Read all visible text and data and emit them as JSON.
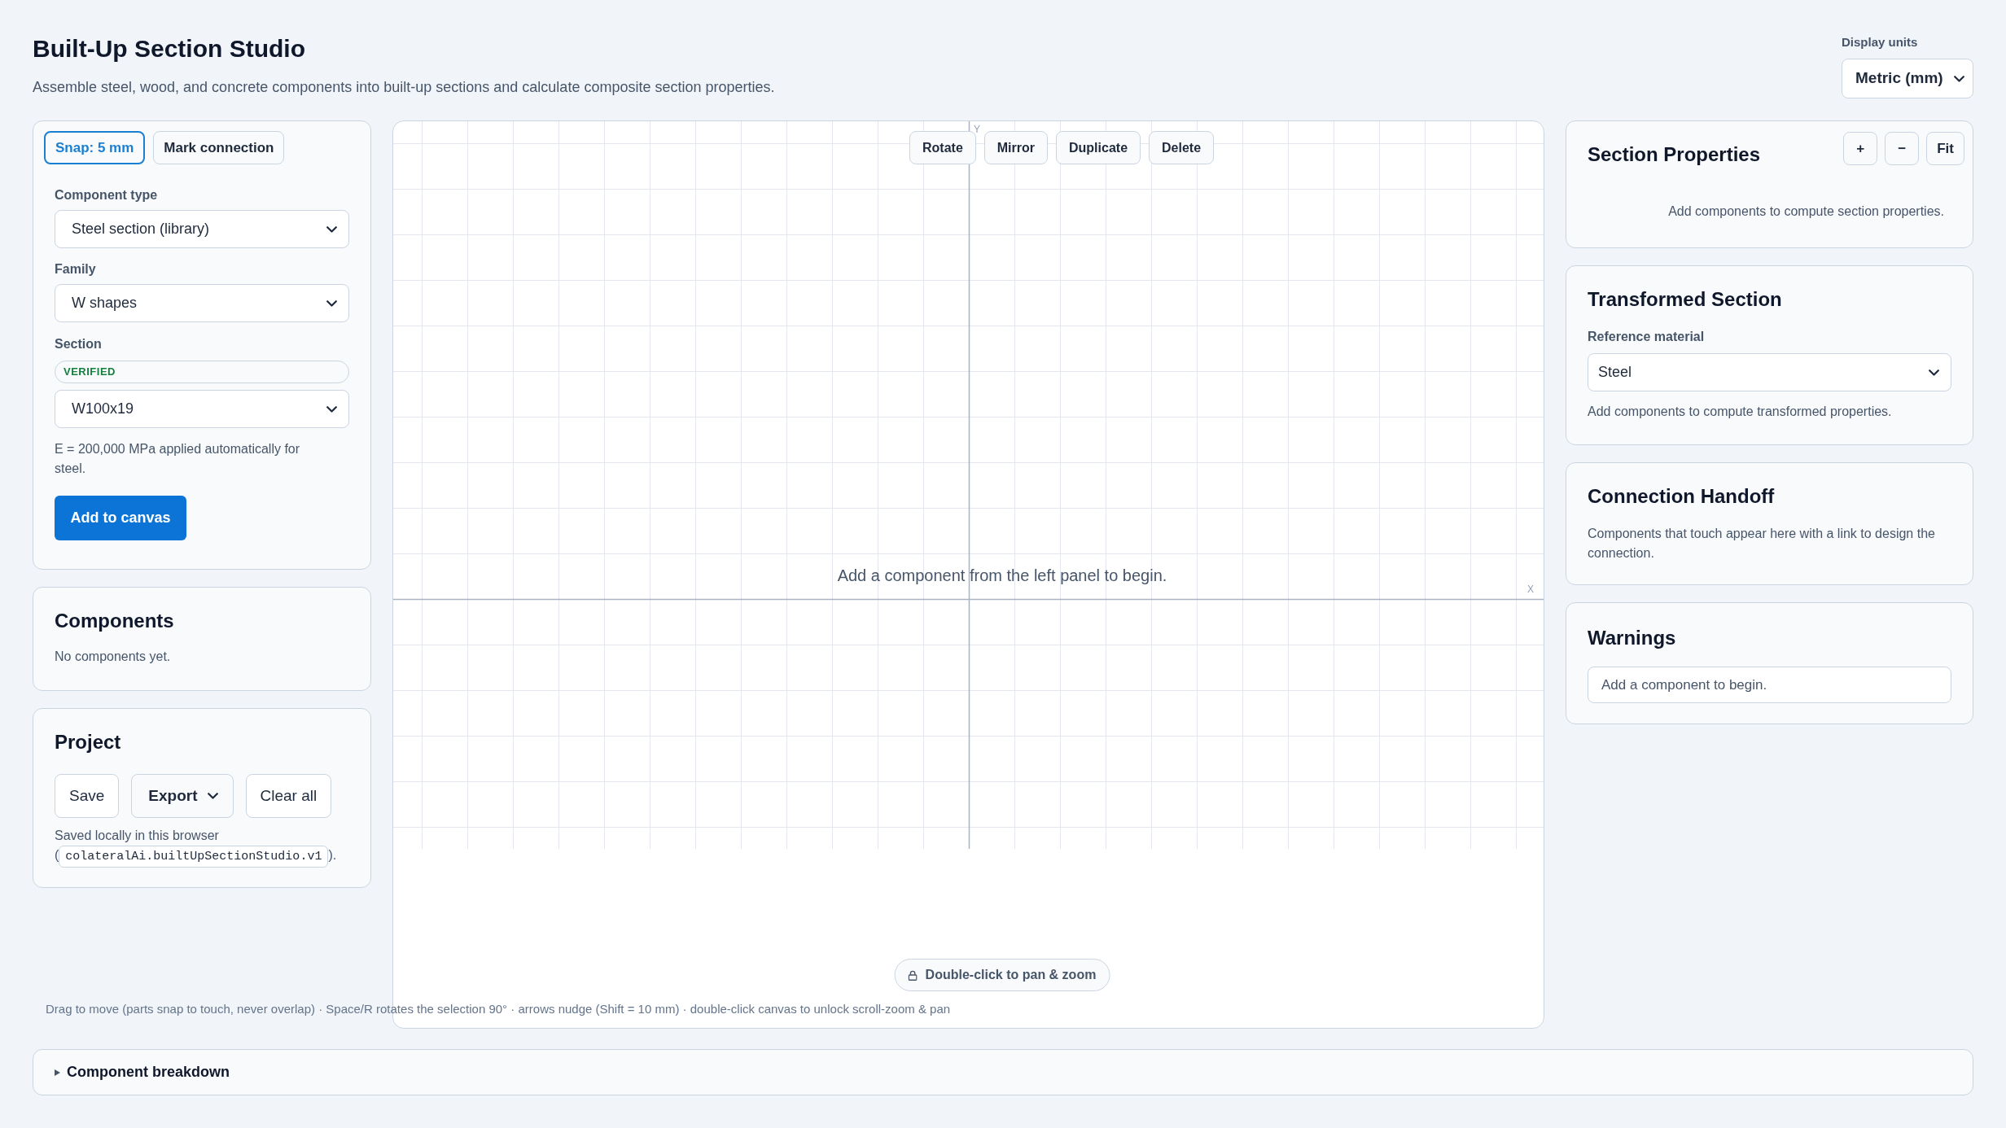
{
  "header": {
    "title": "Built-Up Section Studio",
    "subtitle": "Assemble steel, wood, and concrete components into built-up sections and calculate composite section properties.",
    "units": {
      "label": "Display units",
      "value": "Metric (mm)"
    }
  },
  "tool_toggles": [
    {
      "label": "Snap: 5 mm",
      "on": true
    },
    {
      "label": "Mark connection",
      "on": false
    }
  ],
  "add_panel": {
    "fields": [
      {
        "label": "Component type",
        "value": "Steel section (library)"
      },
      {
        "label": "Family",
        "value": "W shapes"
      },
      {
        "label": "Section",
        "badge": "VERIFIED",
        "value": "W100x19"
      }
    ],
    "note": "E = 200,000 MPa applied automatically for steel.",
    "button": "Add to canvas"
  },
  "components": {
    "title": "Components",
    "empty_text": "No components yet."
  },
  "project": {
    "title": "Project",
    "buttons": [
      {
        "label": "Save",
        "kind": "plain"
      },
      {
        "label": "Export",
        "kind": "dropdown"
      },
      {
        "label": "Clear all",
        "kind": "plain"
      }
    ],
    "note": "Saved locally in this browser",
    "storage_key": {
      "open": "(",
      "key": "colateralAi.builtUpSectionStudio.v1",
      "close": ")."
    }
  },
  "canvas": {
    "toolbar": [
      "Rotate",
      "Mirror",
      "Duplicate",
      "Delete"
    ],
    "axis_labels": {
      "y": "Y",
      "x": "X"
    },
    "empty_message": "Add a component from the left panel to begin.",
    "pan_zoom_button": "Double-click to pan & zoom"
  },
  "hint": "Drag to move (parts snap to touch, never overlap) · Space/R rotates the selection 90° · arrows nudge (Shift = 10 mm) · double-click canvas to unlock scroll-zoom & pan",
  "section_properties": {
    "title": "Section Properties",
    "zoom_buttons": [
      "+",
      "−",
      "Fit"
    ],
    "empty_text": "Add components to compute section properties."
  },
  "transformed_section": {
    "title": "Transformed Section",
    "field": {
      "label": "Reference material",
      "value": "Steel"
    },
    "empty_text": "Add components to compute transformed properties."
  },
  "connection_handoff": {
    "title": "Connection Handoff",
    "text": "Components that touch appear here with a link to design the connection."
  },
  "warnings": {
    "title": "Warnings",
    "items": [
      "Add a component to begin."
    ]
  },
  "breakdown": {
    "title": "Component breakdown",
    "expanded": false
  }
}
